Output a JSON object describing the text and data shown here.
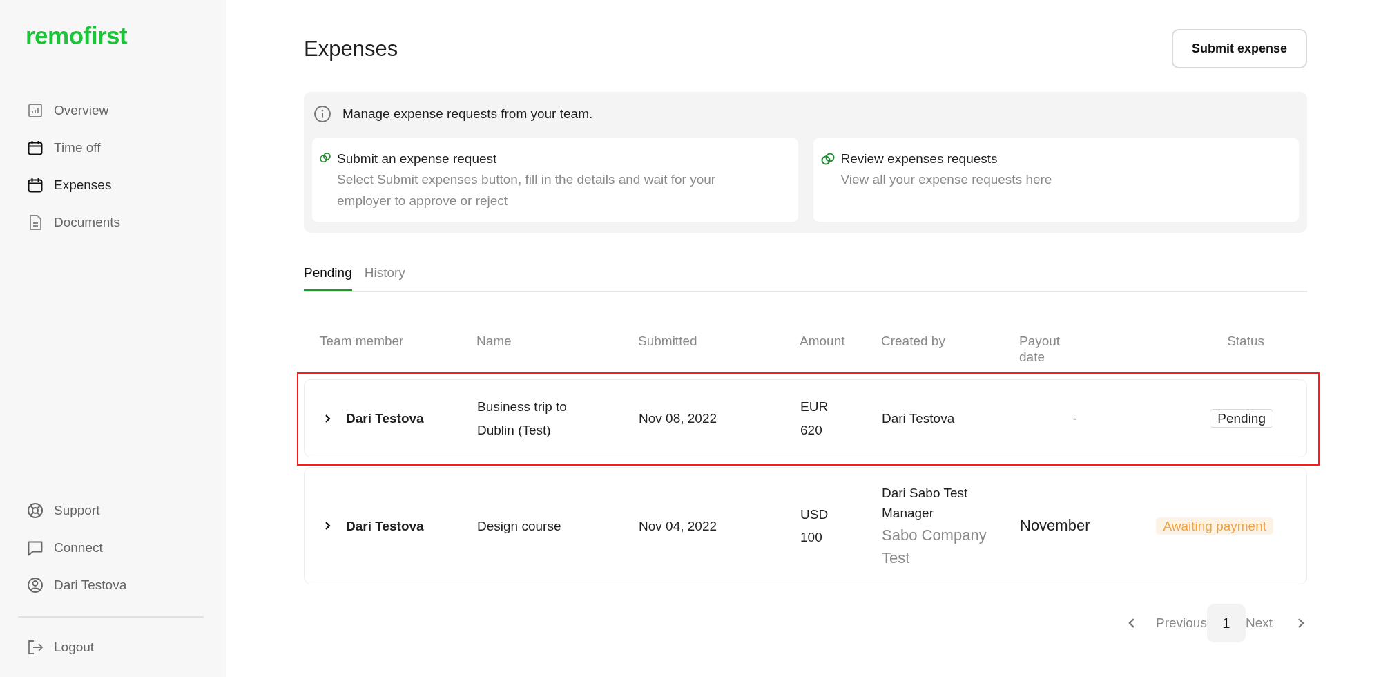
{
  "sidebar": {
    "logo": "remofirst",
    "items": [
      {
        "label": "Overview",
        "selected": false
      },
      {
        "label": "Time off",
        "selected": false
      },
      {
        "label": "Expenses",
        "selected": true
      },
      {
        "label": "Documents",
        "selected": false
      }
    ],
    "bottom_items": [
      {
        "label": "Support"
      },
      {
        "label": "Connect"
      },
      {
        "label": "Dari Testova"
      }
    ],
    "logout": {
      "label": "Logout"
    }
  },
  "page": {
    "title": "Expenses",
    "submit_button": "Submit expense"
  },
  "info": {
    "text": "Manage expense requests from your team.",
    "cards": [
      {
        "title": "Submit an expense request",
        "text": "Select Submit expenses button, fill in the details and wait for your employer to approve or reject"
      },
      {
        "title": "Review expenses requests",
        "text": "View all your expense requests here"
      }
    ]
  },
  "tabs": [
    {
      "label": "Pending",
      "selected": true
    },
    {
      "label": "History",
      "selected": false
    }
  ],
  "table": {
    "columns": [
      "Team member",
      "Name",
      "Submitted",
      "Amount",
      "Created by",
      "Payout date",
      "Status"
    ],
    "rows": [
      {
        "highlighted": true,
        "team_member": "Dari Testova",
        "name": "Business trip to Dublin (Test)",
        "submitted": "Nov 08, 2022",
        "amount": "EUR 620",
        "created_by": "Dari Testova",
        "payout_date": "-",
        "status": {
          "label": "Pending",
          "kind": "outline"
        }
      },
      {
        "highlighted": false,
        "team_member": "Dari Testova",
        "name": "Design course",
        "submitted": "Nov 04, 2022",
        "amount": "USD 100",
        "created_by": "Dari Sabo Test Manager",
        "created_by_company": "Sabo Company Test",
        "payout_date": "November",
        "status": {
          "label": "Awaiting payment",
          "kind": "warning"
        }
      }
    ]
  },
  "pagination": {
    "previous": "Previous",
    "pages": [
      {
        "label": "1",
        "selected": true
      }
    ],
    "next": "Next"
  }
}
